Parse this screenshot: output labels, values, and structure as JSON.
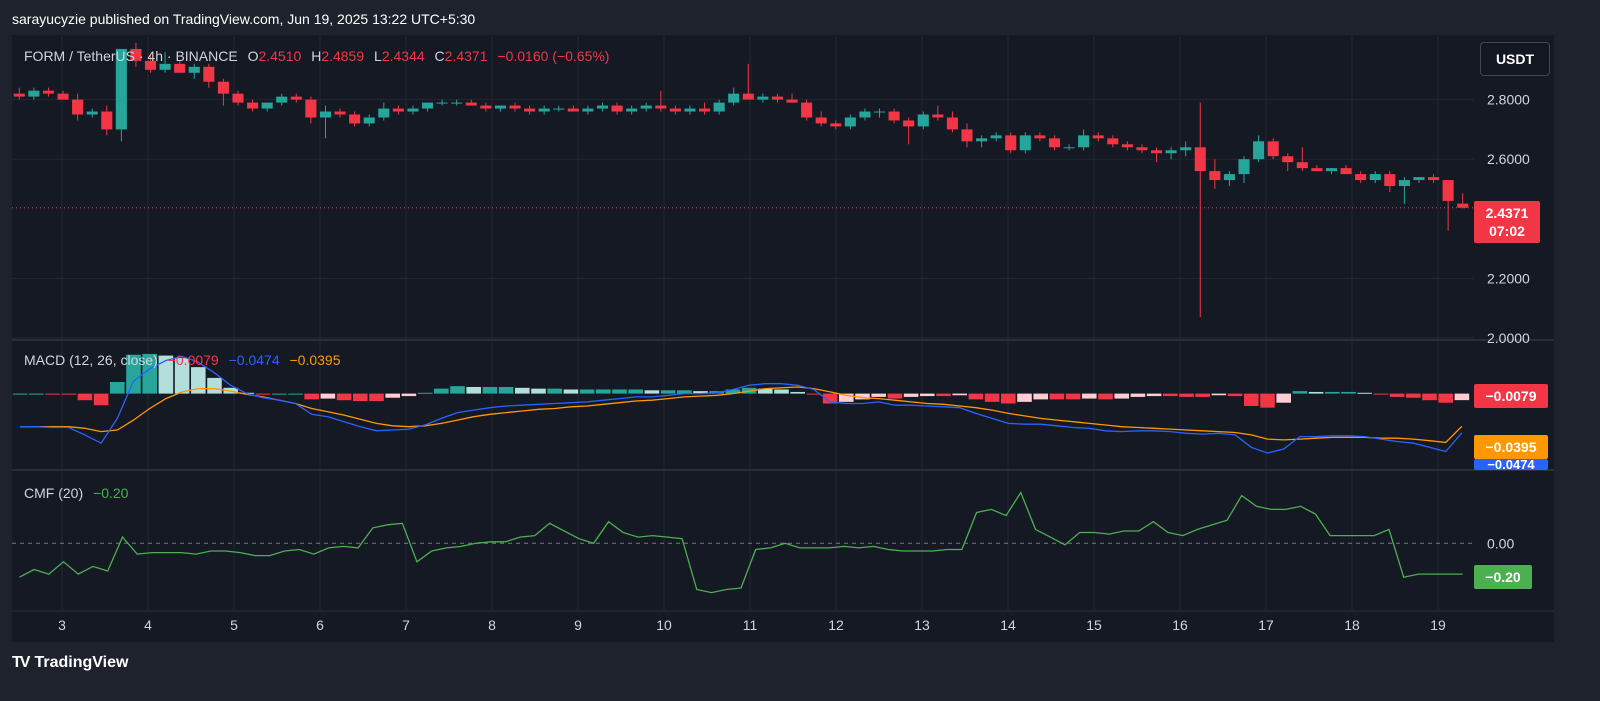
{
  "header": {
    "publish_text": "sarayucyzie published on TradingView.com, Jun 19, 2025 13:22 UTC+5:30"
  },
  "brand": {
    "logo": "TV",
    "name": "TradingView"
  },
  "toolbar": {
    "currency": "USDT"
  },
  "legend": {
    "symbol": "FORM / TetherUS · 4h · BINANCE",
    "o_label": "O",
    "o_value": "2.4510",
    "h_label": "H",
    "h_value": "2.4859",
    "l_label": "L",
    "l_value": "2.4344",
    "c_label": "C",
    "c_value": "2.4371",
    "change": "−0.0160 (−0.65%)"
  },
  "macd_legend": {
    "title": "MACD (12, 26, close)",
    "hist": "−0.0079",
    "macd": "−0.0474",
    "signal": "−0.0395"
  },
  "cmf_legend": {
    "title": "CMF (20)",
    "value": "−0.20"
  },
  "price_tag": {
    "price": "2.4371",
    "countdown": "07:02"
  },
  "macd_tags": {
    "hist": "−0.0079",
    "signal": "−0.0395",
    "macd": "−0.0474"
  },
  "cmf_tag": {
    "value": "−0.20"
  },
  "colors": {
    "bg": "#1e222d",
    "up": "#26a69a",
    "down": "#f23645",
    "macd": "#2962ff",
    "signal": "#ff9800",
    "cmf": "#4caf50"
  },
  "chart_data": [
    {
      "type": "candlestick",
      "title": "FORM / TetherUS · 4h · BINANCE",
      "x_ticks": [
        "3",
        "4",
        "5",
        "6",
        "7",
        "8",
        "9",
        "10",
        "11",
        "12",
        "13",
        "14",
        "15",
        "16",
        "17",
        "18",
        "19"
      ],
      "y_ticks": [
        "2.8000",
        "2.6000",
        "2.2000",
        "2.0000"
      ],
      "ylim": [
        2.0,
        3.0
      ],
      "last_price": 2.4371,
      "ohlc": [
        [
          2.82,
          2.84,
          2.8,
          2.81
        ],
        [
          2.81,
          2.84,
          2.8,
          2.83
        ],
        [
          2.83,
          2.84,
          2.81,
          2.82
        ],
        [
          2.82,
          2.83,
          2.8,
          2.8
        ],
        [
          2.8,
          2.82,
          2.73,
          2.75
        ],
        [
          2.75,
          2.77,
          2.74,
          2.76
        ],
        [
          2.76,
          2.78,
          2.68,
          2.7
        ],
        [
          2.7,
          2.97,
          2.66,
          2.97
        ],
        [
          2.97,
          2.99,
          2.91,
          2.93
        ],
        [
          2.93,
          2.95,
          2.89,
          2.9
        ],
        [
          2.9,
          2.96,
          2.89,
          2.92
        ],
        [
          2.92,
          2.93,
          2.89,
          2.89
        ],
        [
          2.89,
          2.92,
          2.87,
          2.91
        ],
        [
          2.91,
          2.92,
          2.84,
          2.86
        ],
        [
          2.86,
          2.87,
          2.78,
          2.82
        ],
        [
          2.82,
          2.83,
          2.78,
          2.79
        ],
        [
          2.79,
          2.8,
          2.76,
          2.77
        ],
        [
          2.77,
          2.79,
          2.76,
          2.79
        ],
        [
          2.79,
          2.82,
          2.78,
          2.81
        ],
        [
          2.81,
          2.82,
          2.79,
          2.8
        ],
        [
          2.8,
          2.81,
          2.72,
          2.74
        ],
        [
          2.74,
          2.78,
          2.67,
          2.76
        ],
        [
          2.76,
          2.77,
          2.74,
          2.75
        ],
        [
          2.75,
          2.76,
          2.71,
          2.72
        ],
        [
          2.72,
          2.75,
          2.71,
          2.74
        ],
        [
          2.74,
          2.79,
          2.73,
          2.77
        ],
        [
          2.77,
          2.78,
          2.75,
          2.76
        ],
        [
          2.76,
          2.78,
          2.75,
          2.77
        ],
        [
          2.77,
          2.79,
          2.76,
          2.79
        ],
        [
          2.79,
          2.8,
          2.78,
          2.79
        ],
        [
          2.79,
          2.8,
          2.78,
          2.79
        ],
        [
          2.79,
          2.8,
          2.78,
          2.78
        ],
        [
          2.78,
          2.79,
          2.76,
          2.77
        ],
        [
          2.77,
          2.78,
          2.76,
          2.78
        ],
        [
          2.78,
          2.79,
          2.76,
          2.77
        ],
        [
          2.77,
          2.78,
          2.75,
          2.76
        ],
        [
          2.76,
          2.78,
          2.75,
          2.77
        ],
        [
          2.77,
          2.78,
          2.76,
          2.77
        ],
        [
          2.77,
          2.78,
          2.76,
          2.76
        ],
        [
          2.76,
          2.78,
          2.75,
          2.77
        ],
        [
          2.77,
          2.79,
          2.76,
          2.78
        ],
        [
          2.78,
          2.79,
          2.75,
          2.76
        ],
        [
          2.76,
          2.78,
          2.75,
          2.77
        ],
        [
          2.77,
          2.79,
          2.76,
          2.78
        ],
        [
          2.78,
          2.83,
          2.76,
          2.77
        ],
        [
          2.77,
          2.78,
          2.75,
          2.76
        ],
        [
          2.76,
          2.78,
          2.75,
          2.77
        ],
        [
          2.77,
          2.79,
          2.75,
          2.76
        ],
        [
          2.76,
          2.8,
          2.75,
          2.79
        ],
        [
          2.79,
          2.84,
          2.78,
          2.82
        ],
        [
          2.82,
          2.92,
          2.81,
          2.8
        ],
        [
          2.8,
          2.82,
          2.79,
          2.81
        ],
        [
          2.81,
          2.82,
          2.79,
          2.8
        ],
        [
          2.8,
          2.82,
          2.79,
          2.79
        ],
        [
          2.79,
          2.8,
          2.73,
          2.74
        ],
        [
          2.74,
          2.76,
          2.71,
          2.72
        ],
        [
          2.72,
          2.73,
          2.7,
          2.71
        ],
        [
          2.71,
          2.75,
          2.7,
          2.74
        ],
        [
          2.74,
          2.77,
          2.73,
          2.76
        ],
        [
          2.76,
          2.77,
          2.74,
          2.76
        ],
        [
          2.76,
          2.77,
          2.72,
          2.73
        ],
        [
          2.73,
          2.74,
          2.65,
          2.71
        ],
        [
          2.71,
          2.76,
          2.7,
          2.75
        ],
        [
          2.75,
          2.78,
          2.73,
          2.74
        ],
        [
          2.74,
          2.76,
          2.69,
          2.7
        ],
        [
          2.7,
          2.72,
          2.64,
          2.66
        ],
        [
          2.66,
          2.68,
          2.64,
          2.67
        ],
        [
          2.67,
          2.69,
          2.66,
          2.68
        ],
        [
          2.68,
          2.69,
          2.62,
          2.63
        ],
        [
          2.63,
          2.69,
          2.62,
          2.68
        ],
        [
          2.68,
          2.69,
          2.66,
          2.67
        ],
        [
          2.67,
          2.68,
          2.63,
          2.64
        ],
        [
          2.64,
          2.65,
          2.63,
          2.64
        ],
        [
          2.64,
          2.7,
          2.63,
          2.68
        ],
        [
          2.68,
          2.69,
          2.66,
          2.67
        ],
        [
          2.67,
          2.68,
          2.64,
          2.65
        ],
        [
          2.65,
          2.66,
          2.63,
          2.64
        ],
        [
          2.64,
          2.65,
          2.62,
          2.63
        ],
        [
          2.63,
          2.64,
          2.59,
          2.62
        ],
        [
          2.62,
          2.64,
          2.6,
          2.63
        ],
        [
          2.63,
          2.66,
          2.61,
          2.64
        ],
        [
          2.64,
          2.79,
          2.07,
          2.56
        ],
        [
          2.56,
          2.6,
          2.5,
          2.53
        ],
        [
          2.53,
          2.56,
          2.51,
          2.55
        ],
        [
          2.55,
          2.61,
          2.52,
          2.6
        ],
        [
          2.6,
          2.68,
          2.59,
          2.66
        ],
        [
          2.66,
          2.67,
          2.6,
          2.61
        ],
        [
          2.61,
          2.62,
          2.56,
          2.59
        ],
        [
          2.59,
          2.64,
          2.56,
          2.57
        ],
        [
          2.57,
          2.58,
          2.56,
          2.56
        ],
        [
          2.56,
          2.57,
          2.55,
          2.57
        ],
        [
          2.57,
          2.58,
          2.55,
          2.55
        ],
        [
          2.55,
          2.56,
          2.52,
          2.53
        ],
        [
          2.53,
          2.56,
          2.52,
          2.55
        ],
        [
          2.55,
          2.56,
          2.49,
          2.51
        ],
        [
          2.51,
          2.54,
          2.45,
          2.53
        ],
        [
          2.53,
          2.54,
          2.52,
          2.54
        ],
        [
          2.54,
          2.55,
          2.52,
          2.53
        ],
        [
          2.53,
          2.53,
          2.36,
          2.46
        ],
        [
          2.451,
          2.4859,
          2.4344,
          2.4371
        ]
      ]
    },
    {
      "type": "line",
      "title": "MACD (12, 26, close)",
      "ylim": [
        -0.09,
        0.06
      ],
      "zero_tick": "0.0000",
      "series": [
        {
          "name": "MACD",
          "values": [
            -0.04,
            -0.04,
            -0.041,
            -0.041,
            -0.05,
            -0.06,
            -0.03,
            0.015,
            0.03,
            0.04,
            0.045,
            0.038,
            0.025,
            0.01,
            0.0,
            -0.005,
            -0.008,
            -0.012,
            -0.025,
            -0.028,
            -0.034,
            -0.04,
            -0.045,
            -0.044,
            -0.043,
            -0.038,
            -0.03,
            -0.023,
            -0.02,
            -0.017,
            -0.015,
            -0.014,
            -0.013,
            -0.012,
            -0.011,
            -0.01,
            -0.008,
            -0.006,
            -0.004,
            -0.004,
            -0.002,
            0.0,
            0.0,
            0.001,
            0.005,
            0.01,
            0.012,
            0.012,
            0.01,
            0.005,
            -0.01,
            -0.012,
            -0.012,
            -0.01,
            -0.014,
            -0.014,
            -0.015,
            -0.016,
            -0.017,
            -0.024,
            -0.03,
            -0.036,
            -0.037,
            -0.037,
            -0.039,
            -0.041,
            -0.042,
            -0.045,
            -0.046,
            -0.045,
            -0.045,
            -0.046,
            -0.048,
            -0.049,
            -0.048,
            -0.05,
            -0.065,
            -0.072,
            -0.067,
            -0.052,
            -0.052,
            -0.051,
            -0.051,
            -0.052,
            -0.055,
            -0.058,
            -0.06,
            -0.065,
            -0.07,
            -0.0474
          ]
        },
        {
          "name": "Signal",
          "values": [
            -0.04,
            -0.04,
            -0.04,
            -0.04,
            -0.042,
            -0.046,
            -0.044,
            -0.032,
            -0.018,
            -0.006,
            0.002,
            0.006,
            0.006,
            0.003,
            -0.001,
            -0.004,
            -0.008,
            -0.012,
            -0.018,
            -0.022,
            -0.026,
            -0.031,
            -0.036,
            -0.039,
            -0.04,
            -0.039,
            -0.036,
            -0.032,
            -0.028,
            -0.025,
            -0.023,
            -0.021,
            -0.019,
            -0.018,
            -0.016,
            -0.015,
            -0.013,
            -0.011,
            -0.009,
            -0.008,
            -0.006,
            -0.004,
            -0.003,
            -0.002,
            0.0,
            0.003,
            0.006,
            0.007,
            0.008,
            0.006,
            0.002,
            -0.002,
            -0.005,
            -0.006,
            -0.008,
            -0.01,
            -0.012,
            -0.013,
            -0.015,
            -0.017,
            -0.02,
            -0.024,
            -0.027,
            -0.03,
            -0.032,
            -0.034,
            -0.036,
            -0.038,
            -0.04,
            -0.041,
            -0.042,
            -0.043,
            -0.044,
            -0.045,
            -0.046,
            -0.047,
            -0.05,
            -0.055,
            -0.056,
            -0.055,
            -0.054,
            -0.053,
            -0.053,
            -0.053,
            -0.054,
            -0.054,
            -0.055,
            -0.057,
            -0.059,
            -0.0395
          ]
        },
        {
          "name": "Histogram",
          "values": [
            0.0,
            0.0,
            -0.001,
            -0.001,
            -0.008,
            -0.014,
            0.014,
            0.047,
            0.048,
            0.046,
            0.043,
            0.032,
            0.019,
            0.007,
            0.001,
            -0.001,
            0.0,
            0.0,
            -0.007,
            -0.006,
            -0.008,
            -0.009,
            -0.009,
            -0.005,
            -0.003,
            0.001,
            0.006,
            0.009,
            0.008,
            0.008,
            0.008,
            0.007,
            0.006,
            0.006,
            0.005,
            0.005,
            0.005,
            0.005,
            0.005,
            0.004,
            0.004,
            0.004,
            0.003,
            0.003,
            0.005,
            0.007,
            0.006,
            0.005,
            0.002,
            -0.001,
            -0.012,
            -0.01,
            -0.007,
            -0.004,
            -0.006,
            -0.004,
            -0.003,
            -0.003,
            -0.002,
            -0.007,
            -0.01,
            -0.012,
            -0.01,
            -0.007,
            -0.007,
            -0.007,
            -0.006,
            -0.007,
            -0.006,
            -0.004,
            -0.003,
            -0.003,
            -0.004,
            -0.004,
            -0.002,
            -0.003,
            -0.015,
            -0.017,
            -0.011,
            0.003,
            0.002,
            0.002,
            0.002,
            0.001,
            -0.001,
            -0.004,
            -0.005,
            -0.008,
            -0.011,
            -0.0079
          ]
        }
      ]
    },
    {
      "type": "line",
      "title": "CMF (20)",
      "ylim": [
        -0.42,
        0.45
      ],
      "zero_tick": "0.00",
      "series": [
        {
          "name": "CMF",
          "values": [
            -0.22,
            -0.17,
            -0.2,
            -0.12,
            -0.2,
            -0.15,
            -0.18,
            0.04,
            -0.07,
            -0.06,
            -0.06,
            -0.06,
            -0.07,
            -0.05,
            -0.05,
            -0.06,
            -0.08,
            -0.08,
            -0.05,
            -0.04,
            -0.07,
            -0.03,
            -0.02,
            -0.03,
            0.1,
            0.12,
            0.13,
            -0.12,
            -0.05,
            -0.03,
            -0.02,
            0.0,
            0.01,
            0.01,
            0.04,
            0.05,
            0.13,
            0.08,
            0.03,
            0.0,
            0.14,
            0.07,
            0.04,
            0.05,
            0.04,
            0.03,
            -0.3,
            -0.32,
            -0.3,
            -0.29,
            -0.04,
            -0.03,
            0.0,
            -0.03,
            -0.03,
            -0.03,
            -0.02,
            -0.03,
            -0.02,
            -0.04,
            -0.05,
            -0.05,
            -0.05,
            -0.04,
            -0.04,
            0.2,
            0.22,
            0.18,
            0.33,
            0.09,
            0.04,
            -0.01,
            0.07,
            0.07,
            0.06,
            0.08,
            0.08,
            0.14,
            0.07,
            0.05,
            0.09,
            0.12,
            0.15,
            0.31,
            0.24,
            0.22,
            0.22,
            0.24,
            0.19,
            0.05,
            0.05,
            0.05,
            0.05,
            0.09,
            -0.22,
            -0.2,
            -0.2,
            -0.2,
            -0.2
          ]
        }
      ]
    }
  ]
}
